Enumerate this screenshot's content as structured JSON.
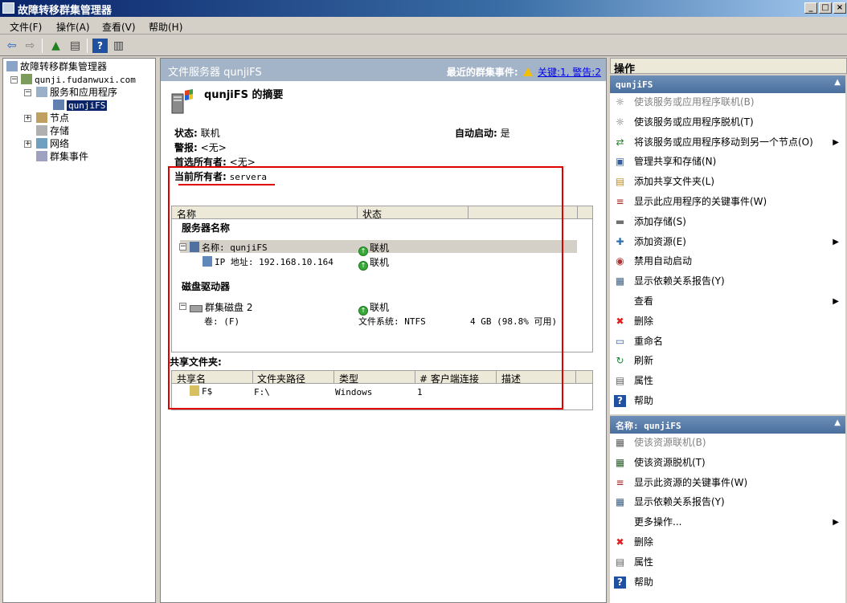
{
  "window": {
    "title": "故障转移群集管理器",
    "controls": [
      "_",
      "□",
      "×"
    ]
  },
  "menu": [
    "文件(F)",
    "操作(A)",
    "查看(V)",
    "帮助(H)"
  ],
  "tree": {
    "root": "故障转移群集管理器",
    "cluster": "qunji.fudanwuxi.com",
    "services": "服务和应用程序",
    "selected": "qunjiFS",
    "nodes": "节点",
    "storage": "存储",
    "network": "网络",
    "events": "群集事件"
  },
  "center": {
    "header_left": "文件服务器 qunjiFS",
    "header_right_label": "最近的群集事件:",
    "header_right_link": "关键:1, 警告:2",
    "summary_title": "qunjiFS 的摘要",
    "status_label": "状态:",
    "status_value": "联机",
    "autostart_label": "自动启动:",
    "autostart_value": "是",
    "alert_label": "警报:",
    "alert_value": "<无>",
    "preferred_label": "首选所有者:",
    "preferred_value": "<无>",
    "owner_label": "当前所有者:",
    "owner_value": "servera",
    "grid_cols": [
      "名称",
      "状态"
    ],
    "section_server": "服务器名称",
    "server_row_name": "名称: qunjiFS",
    "server_row_status": "联机",
    "ip_row_name": "IP 地址: 192.168.10.164",
    "ip_row_status": "联机",
    "section_disk": "磁盘驱动器",
    "disk_row_name": "群集磁盘 2",
    "disk_row_status": "联机",
    "volume_label": "卷: (F)",
    "volume_fs": "文件系统: NTFS",
    "volume_size": "4 GB (98.8% 可用)",
    "shares_title": "共享文件夹:",
    "share_cols": [
      "共享名",
      "文件夹路径",
      "类型",
      "# 客户端连接",
      "描述"
    ],
    "share_row": {
      "name": "F$",
      "path": "F:\\",
      "type": "Windows",
      "connections": "1",
      "desc": ""
    }
  },
  "actions": {
    "title": "操作",
    "section1": "qunjiFS",
    "items1": [
      {
        "label": "使该服务或应用程序联机(B)",
        "icon": "gear-icon",
        "disabled": true
      },
      {
        "label": "使该服务或应用程序脱机(T)",
        "icon": "gear-icon",
        "disabled": false
      },
      {
        "label": "将该服务或应用程序移动到另一个节点(O)",
        "icon": "move-icon",
        "disabled": false,
        "submenu": true
      },
      {
        "label": "管理共享和存储(N)",
        "icon": "share-icon",
        "disabled": false
      },
      {
        "label": "添加共享文件夹(L)",
        "icon": "folder-icon",
        "disabled": false
      },
      {
        "label": "显示此应用程序的关键事件(W)",
        "icon": "event-icon",
        "disabled": false
      },
      {
        "label": "添加存储(S)",
        "icon": "storage-icon",
        "disabled": false
      },
      {
        "label": "添加资源(E)",
        "icon": "resource-icon",
        "disabled": false,
        "submenu": true
      },
      {
        "label": "禁用自动启动",
        "icon": "disable-icon",
        "disabled": false
      },
      {
        "label": "显示依赖关系报告(Y)",
        "icon": "report-icon",
        "disabled": false
      },
      {
        "label": "查看",
        "icon": "",
        "disabled": false,
        "submenu": true
      },
      {
        "label": "删除",
        "icon": "delete-icon",
        "disabled": false
      },
      {
        "label": "重命名",
        "icon": "rename-icon",
        "disabled": false
      },
      {
        "label": "刷新",
        "icon": "refresh-icon",
        "disabled": false
      },
      {
        "label": "属性",
        "icon": "properties-icon",
        "disabled": false
      },
      {
        "label": "帮助",
        "icon": "help-icon",
        "disabled": false
      }
    ],
    "section2": "名称: qunjiFS",
    "items2": [
      {
        "label": "使该资源联机(B)",
        "icon": "resource-online-icon",
        "disabled": true
      },
      {
        "label": "使该资源脱机(T)",
        "icon": "resource-offline-icon",
        "disabled": false
      },
      {
        "label": "显示此资源的关键事件(W)",
        "icon": "event-icon",
        "disabled": false
      },
      {
        "label": "显示依赖关系报告(Y)",
        "icon": "report-icon",
        "disabled": false
      },
      {
        "label": "更多操作...",
        "icon": "",
        "disabled": false,
        "submenu": true
      },
      {
        "label": "删除",
        "icon": "delete-icon",
        "disabled": false
      },
      {
        "label": "属性",
        "icon": "properties-icon",
        "disabled": false
      },
      {
        "label": "帮助",
        "icon": "help-icon",
        "disabled": false
      }
    ]
  }
}
